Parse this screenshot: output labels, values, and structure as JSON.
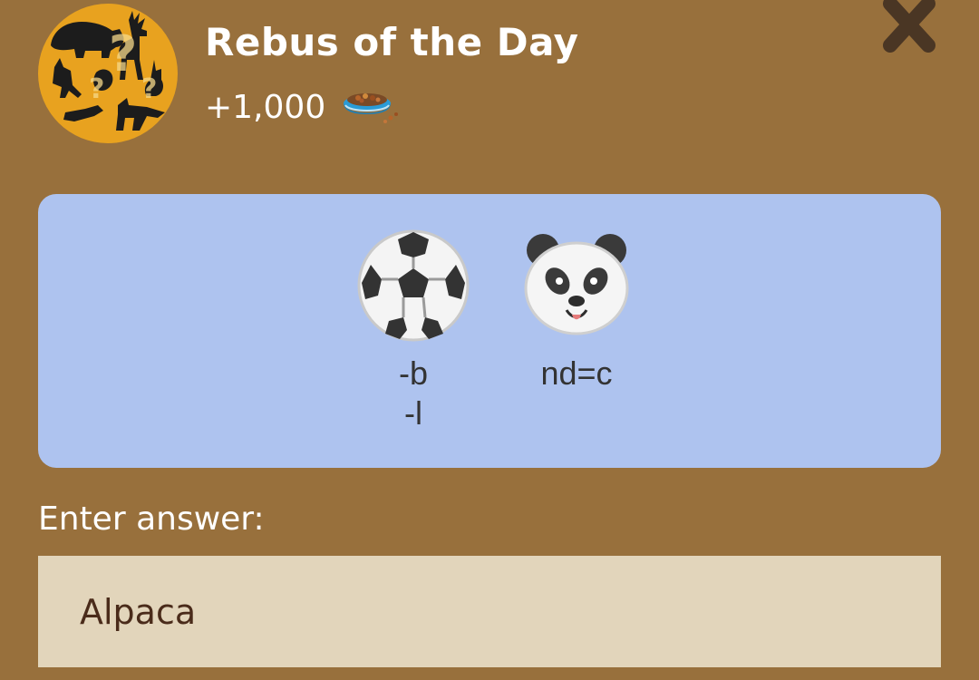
{
  "header": {
    "title": "Rebus of the Day",
    "reward_value": "+1,000",
    "reward_icon": "pet-food-bowl-icon",
    "avatar_icon": "animal-silhouettes-question-mark-icon",
    "close_icon": "close-x-icon"
  },
  "puzzle": {
    "items": [
      {
        "icon": "soccer-ball-icon",
        "hint_line_1": "-b",
        "hint_line_2": "-l"
      },
      {
        "icon": "panda-face-icon",
        "hint_line_1": "nd=c",
        "hint_line_2": ""
      }
    ]
  },
  "answer": {
    "label": "Enter answer:",
    "value": "Alpaca"
  },
  "colors": {
    "background": "#98703c",
    "card": "#aec3ef",
    "input": "#e2d5bb",
    "avatar": "#e8a21f",
    "close": "#4a3624"
  }
}
